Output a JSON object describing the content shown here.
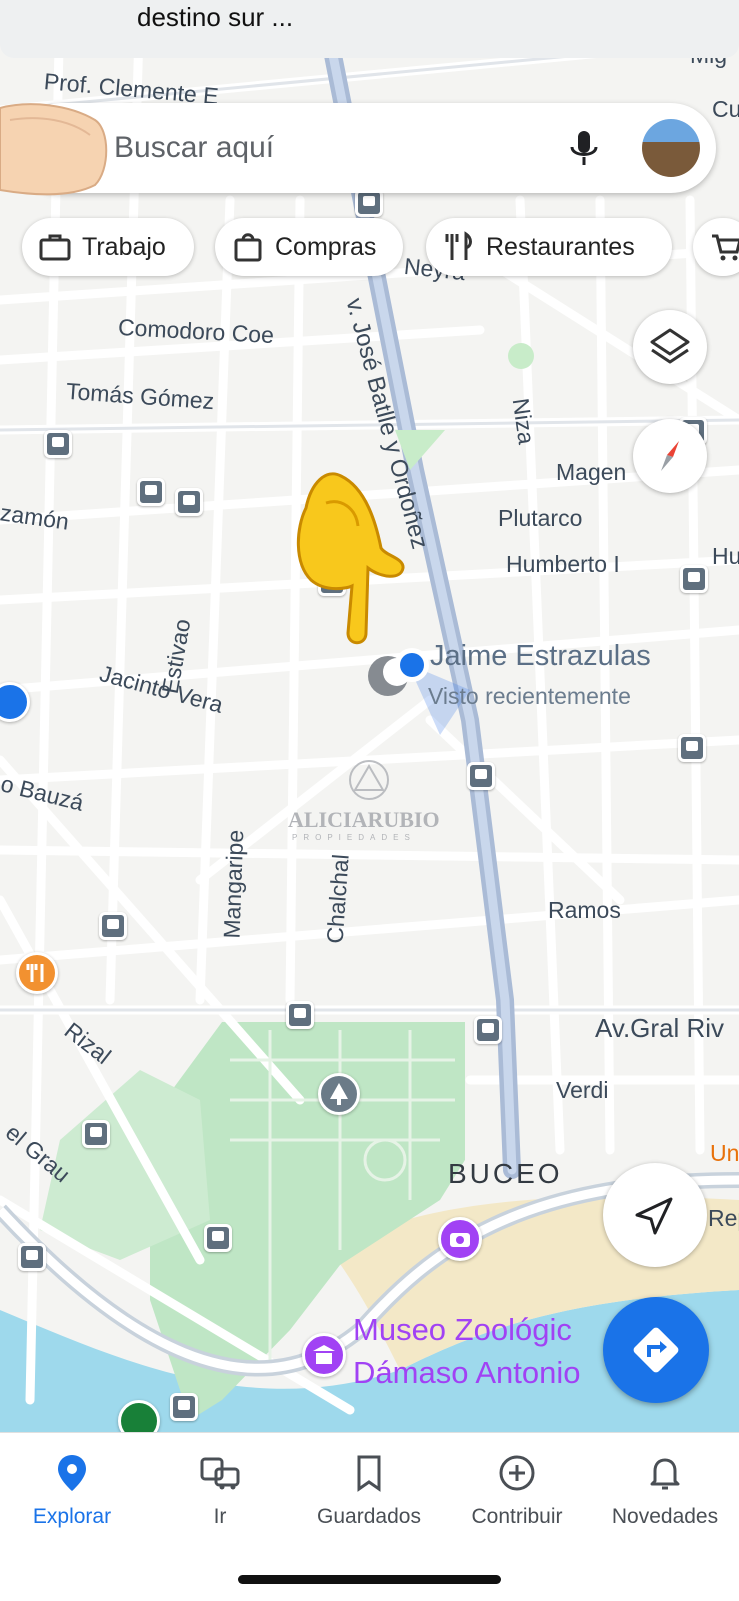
{
  "status": {
    "banner_text": "destino sur ..."
  },
  "search": {
    "placeholder": "Buscar aquí"
  },
  "chips": [
    {
      "label": "Trabajo",
      "icon": "briefcase-icon"
    },
    {
      "label": "Compras",
      "icon": "shopping-bag-icon"
    },
    {
      "label": "Restaurantes",
      "icon": "fork-knife-icon"
    }
  ],
  "map": {
    "streets": {
      "prof_clemente": "Prof. Clemente E",
      "comodoro_coe": "Comodoro Coe",
      "tomas_gomez": "Tomás Gómez",
      "zamon": "zamón",
      "jacinto_vera": "Jacinto Vera",
      "estivao": "Estivao",
      "bauza": "o Bauzá",
      "mangaripe": "Mangaripe",
      "chalchal": "Chalchal",
      "rizal": "Rizal",
      "el_grau": "el Grau",
      "jose_batlle": "v. José Batlle y Ordoñez",
      "neyra": "Neyra",
      "niza": "Niza",
      "magen": "Magen",
      "plutarco": "Plutarco",
      "humberto": "Humberto I",
      "hu": "Hu",
      "ramos": "Ramos",
      "gral_rivera": "Av.Gral Riv",
      "verdi": "Verdi",
      "rep": "Rep",
      "un": "Un",
      "mig": "Mig",
      "cu": "Cu"
    },
    "neighborhood": "BUCEO",
    "location": {
      "name": "Jaime Estrazulas",
      "subtitle": "Visto recientemente"
    },
    "watermark": {
      "name": "ALICIARUBIO",
      "sub": "PROPIEDADES"
    },
    "museum": {
      "line1": "Museo Zoológic",
      "line2": "Dámaso Antonio"
    }
  },
  "nav": [
    {
      "label": "Explorar",
      "icon": "location-pin-icon",
      "active": true
    },
    {
      "label": "Ir",
      "icon": "commute-icon",
      "active": false
    },
    {
      "label": "Guardados",
      "icon": "bookmark-icon",
      "active": false
    },
    {
      "label": "Contribuir",
      "icon": "add-circle-icon",
      "active": false
    },
    {
      "label": "Novedades",
      "icon": "bell-icon",
      "active": false
    }
  ],
  "colors": {
    "accent": "#1a73e8",
    "park": "#bfe6c5",
    "water": "#9ed9ec",
    "museum": "#a142f4"
  }
}
